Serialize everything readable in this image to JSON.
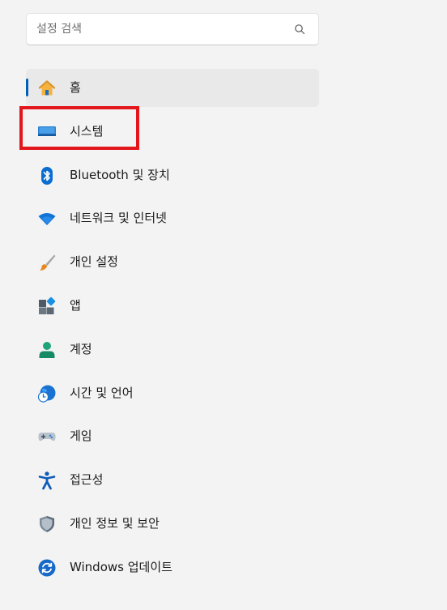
{
  "search": {
    "placeholder": "설정 검색",
    "icon": "search-icon"
  },
  "nav": {
    "items": [
      {
        "label": "홈",
        "icon": "home-icon",
        "selected": true
      },
      {
        "label": "시스템",
        "icon": "system-icon",
        "selected": false,
        "highlighted": true
      },
      {
        "label": "Bluetooth 및 장치",
        "icon": "bluetooth-icon",
        "selected": false
      },
      {
        "label": "네트워크 및 인터넷",
        "icon": "wifi-icon",
        "selected": false
      },
      {
        "label": "개인 설정",
        "icon": "brush-icon",
        "selected": false
      },
      {
        "label": "앱",
        "icon": "apps-icon",
        "selected": false
      },
      {
        "label": "계정",
        "icon": "account-icon",
        "selected": false
      },
      {
        "label": "시간 및 언어",
        "icon": "time-language-icon",
        "selected": false
      },
      {
        "label": "게임",
        "icon": "gamepad-icon",
        "selected": false
      },
      {
        "label": "접근성",
        "icon": "accessibility-icon",
        "selected": false
      },
      {
        "label": "개인 정보 및 보안",
        "icon": "shield-icon",
        "selected": false
      },
      {
        "label": "Windows 업데이트",
        "icon": "update-icon",
        "selected": false
      }
    ]
  },
  "colors": {
    "accent": "#005fb8",
    "highlight_border": "#e3161b",
    "background": "#f3f3f3",
    "selected_bg": "#e9e9e9"
  }
}
